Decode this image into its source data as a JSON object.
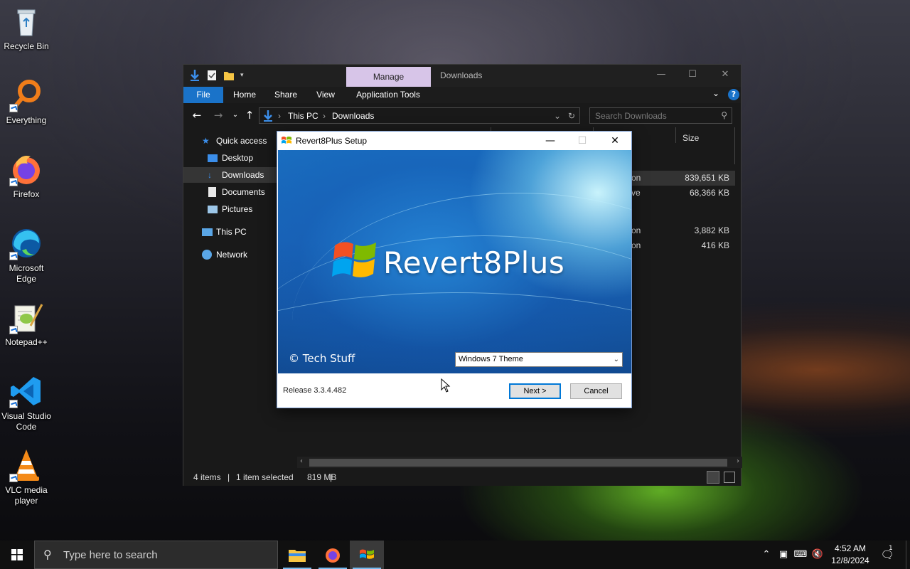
{
  "desktop": {
    "icons": [
      {
        "label": "Recycle Bin",
        "icon": "recycle-bin-icon"
      },
      {
        "label": "Everything",
        "icon": "everything-search-icon"
      },
      {
        "label": "Firefox",
        "icon": "firefox-icon"
      },
      {
        "label": "Microsoft Edge",
        "label_line1": "Microsoft",
        "label_line2": "Edge",
        "icon": "edge-icon"
      },
      {
        "label": "Notepad++",
        "icon": "notepadpp-icon"
      },
      {
        "label": "Visual Studio Code",
        "label_line1": "Visual Studio",
        "label_line2": "Code",
        "icon": "vscode-icon"
      },
      {
        "label": "VLC media player",
        "label_line1": "VLC media",
        "label_line2": "player",
        "icon": "vlc-icon"
      }
    ]
  },
  "explorer": {
    "title": "Downloads",
    "contextual_tab": "Manage",
    "ribbon_tabs": [
      "File",
      "Home",
      "Share",
      "View",
      "Application Tools"
    ],
    "breadcrumb": [
      "This PC",
      "Downloads"
    ],
    "search_placeholder": "Search Downloads",
    "nav": {
      "quick_access": "Quick access",
      "desktop": "Desktop",
      "downloads": "Downloads",
      "documents": "Documents",
      "pictures": "Pictures",
      "this_pc": "This PC",
      "network": "Network"
    },
    "column_size": "Size",
    "files": [
      {
        "type_fragment": "on",
        "size": "839,651 KB",
        "selected": true
      },
      {
        "type_fragment": "ve",
        "size": "68,366 KB",
        "selected": false
      },
      {
        "type_fragment": "on",
        "size": "3,882 KB",
        "selected": false
      },
      {
        "type_fragment": "on",
        "size": "416 KB",
        "selected": false
      }
    ],
    "status": {
      "items": "4 items",
      "selected": "1 item selected",
      "size": "819 MB"
    }
  },
  "setup": {
    "title": "Revert8Plus Setup",
    "brand": "Revert8Plus",
    "copyright": "© Tech Stuff",
    "theme_selected": "Windows 7 Theme",
    "release": "Release 3.3.4.482",
    "next_label": "Next >",
    "cancel_label": "Cancel"
  },
  "taskbar": {
    "search_placeholder": "Type here to search",
    "time": "4:52 AM",
    "date": "12/8/2024",
    "notification_count": "1"
  },
  "colors": {
    "accent": "#1a73c9",
    "manage_tab": "#d7c5e8",
    "taskbar_underline": "#76b9ed"
  }
}
